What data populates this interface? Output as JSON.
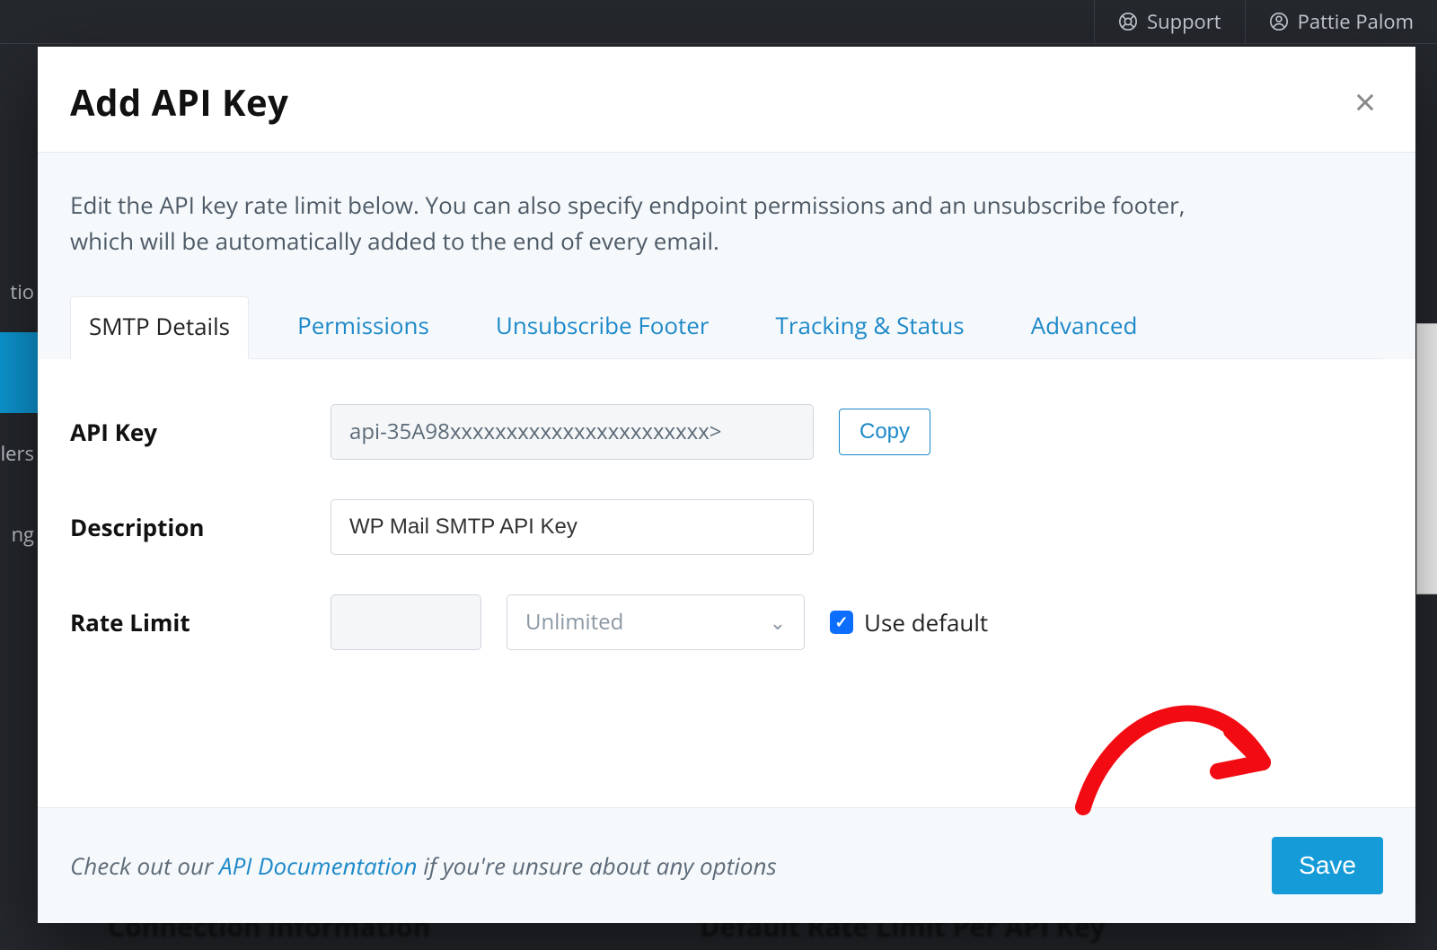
{
  "topbar": {
    "support": "Support",
    "user": "Pattie Palom"
  },
  "bg": {
    "heading_left": "Connection information",
    "heading_right": "Default Rate Limit Per API Key",
    "side_frag_1": "tio",
    "side_frag_2": "",
    "side_frag_3": "lers",
    "side_frag_4": "ng"
  },
  "modal": {
    "title": "Add API Key",
    "intro": "Edit the API key rate limit below. You can also specify endpoint permissions and an unsubscribe footer, which will be automatically added to the end of every email.",
    "tabs": [
      {
        "label": "SMTP Details",
        "active": true
      },
      {
        "label": "Permissions",
        "active": false
      },
      {
        "label": "Unsubscribe Footer",
        "active": false
      },
      {
        "label": "Tracking & Status",
        "active": false
      },
      {
        "label": "Advanced",
        "active": false
      }
    ],
    "fields": {
      "api_key_label": "API Key",
      "api_key_value": "api-35A98xxxxxxxxxxxxxxxxxxxxxxx>",
      "copy_label": "Copy",
      "description_label": "Description",
      "description_value": "WP Mail SMTP API Key",
      "rate_limit_label": "Rate Limit",
      "rate_limit_value": "",
      "rate_limit_select": "Unlimited",
      "use_default_label": "Use default",
      "use_default_checked": true
    },
    "footer": {
      "prefix": "Check out our ",
      "link": "API Documentation",
      "suffix": " if you're unsure about any options",
      "save": "Save"
    }
  }
}
